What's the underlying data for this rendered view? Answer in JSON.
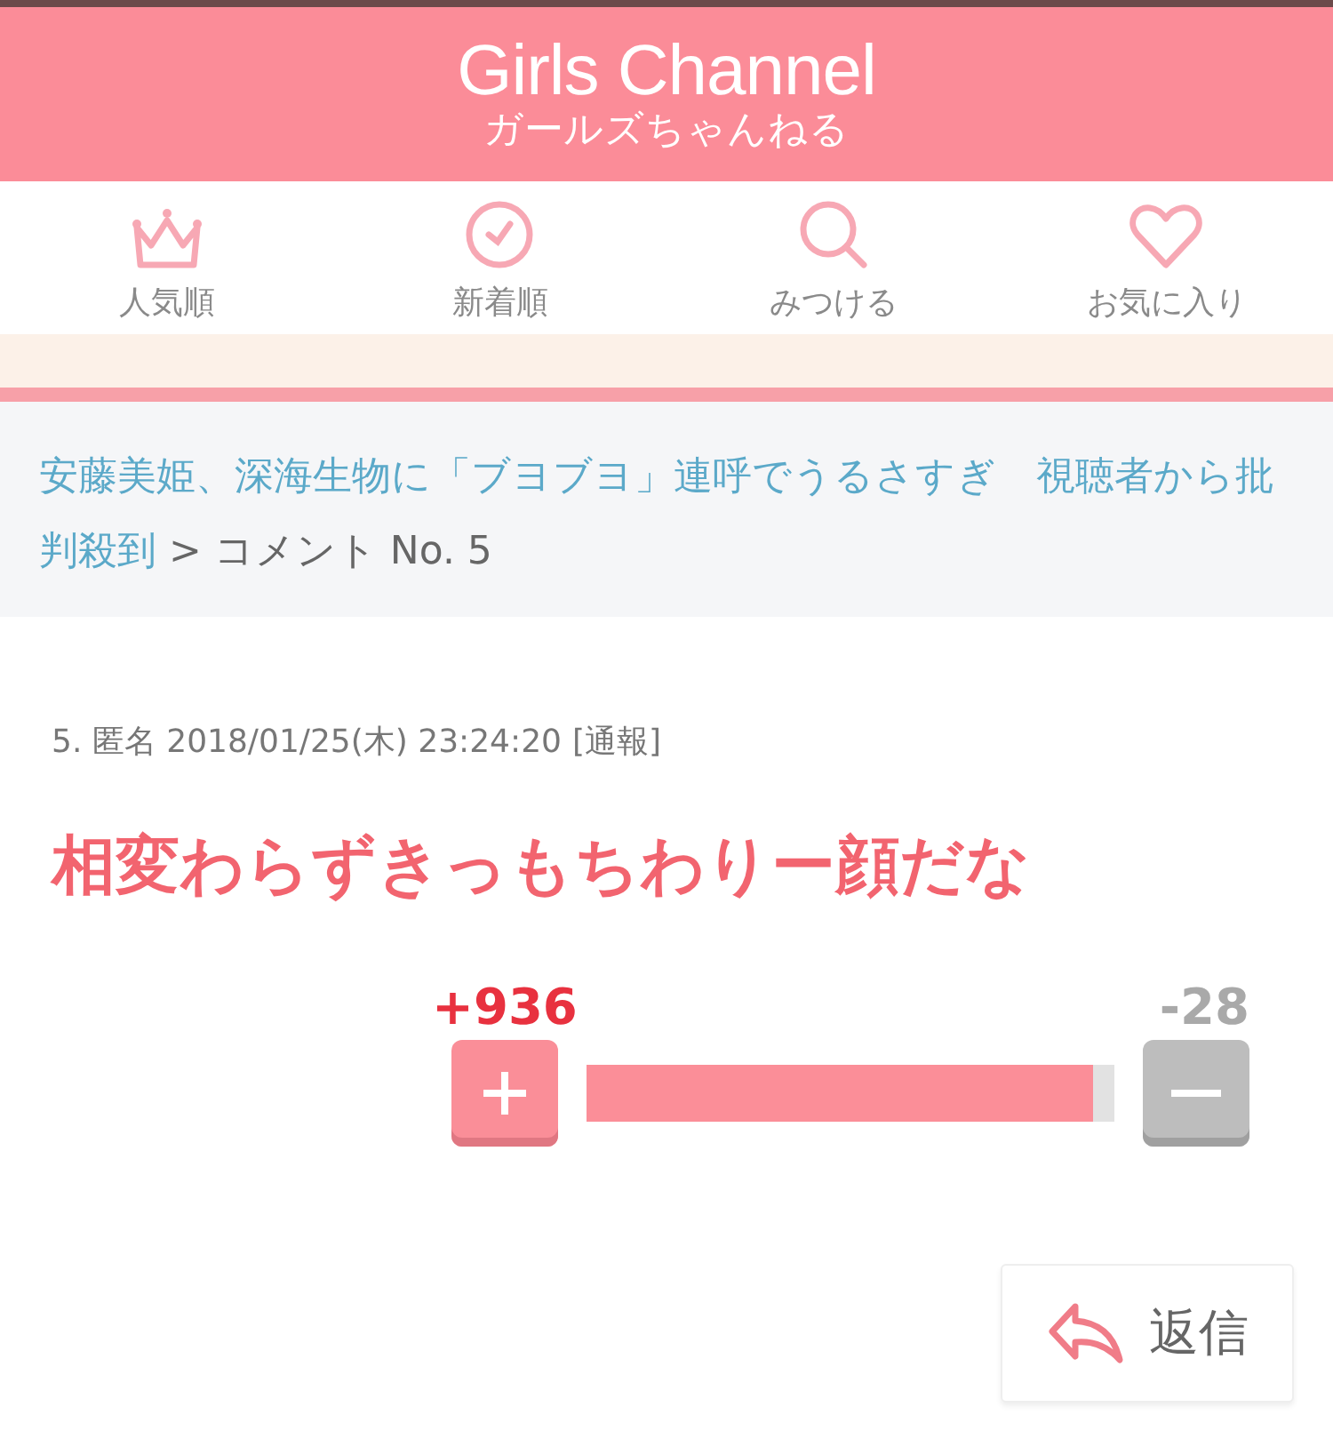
{
  "header": {
    "logo": "Girls Channel",
    "subtitle": "ガールズちゃんねる"
  },
  "nav": [
    {
      "label": "人気順"
    },
    {
      "label": "新着順"
    },
    {
      "label": "みつける"
    },
    {
      "label": "お気に入り"
    }
  ],
  "breadcrumb": {
    "link": "安藤美姫、深海生物に「ブヨブヨ」連呼でうるさすぎ　視聴者から批判殺到",
    "current": "> コメント No. 5"
  },
  "comment": {
    "meta": "5. 匿名 2018/01/25(木) 23:24:20",
    "report_link": "[通報]",
    "body": "相変わらずきっもちわりー顔だな"
  },
  "vote": {
    "plus_count": "+936",
    "minus_count": "-28",
    "level": 0.96
  },
  "reply_button": "返信"
}
